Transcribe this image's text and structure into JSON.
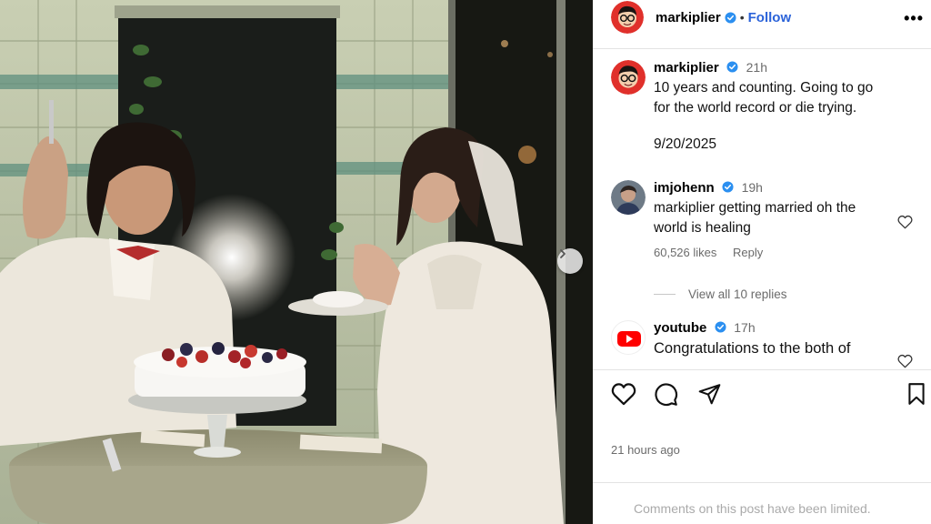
{
  "header": {
    "username": "markiplier",
    "separator": "•",
    "follow_label": "Follow",
    "more_label": "•••"
  },
  "caption": {
    "username": "markiplier",
    "time": "21h",
    "text": "10 years and counting. Going to go for the world record or die trying.",
    "date": "9/20/2025"
  },
  "comments": [
    {
      "username": "imjohenn",
      "time": "19h",
      "text": "markiplier getting married oh the world is healing",
      "likes": "60,526 likes",
      "reply_label": "Reply",
      "view_replies": "View all 10 replies"
    },
    {
      "username": "youtube",
      "time": "17h",
      "text": "Congratulations to the both of"
    }
  ],
  "post": {
    "posted_ago": "21 hours ago",
    "comments_limited": "Comments on this post have been limited."
  },
  "icons": {
    "verified": "verified-badge-icon",
    "like": "heart-icon",
    "comment": "comment-bubble-icon",
    "share": "paper-plane-icon",
    "save": "bookmark-icon",
    "next": "chevron-right-icon"
  },
  "colors": {
    "accent": "#2b63d9",
    "verified": "#2b8ff0",
    "youtube": "#ff0000"
  }
}
